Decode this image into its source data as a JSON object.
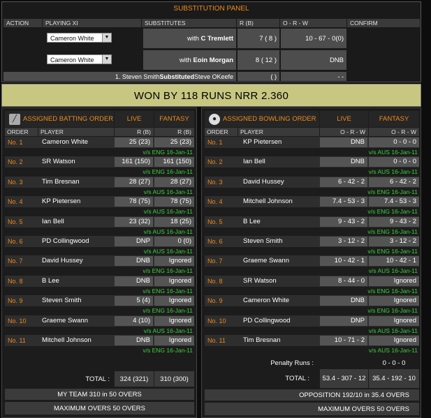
{
  "substitution": {
    "title": "SUBSTITUTION PANEL",
    "headers": [
      "ACTION",
      "PLAYING XI",
      "SUBSTITUTES",
      "R (B)",
      "O - R - W",
      "CONFIRM"
    ],
    "rows": [
      {
        "playing": "Cameron White",
        "prefix": "with",
        "sub": "C Tremlett",
        "rb": "7 ( 8 )",
        "orw": "10 - 67 - 0(0)"
      },
      {
        "playing": "Cameron White",
        "prefix": "with",
        "sub": "Eoin Morgan",
        "rb": "8 ( 12 )",
        "orw": "DNB"
      }
    ],
    "history": {
      "text": "1.  Steven Smith ",
      "bold": "Substituted",
      "rest": " Steve OKeefe",
      "rb": "( )",
      "orw": "- -"
    }
  },
  "result": "WON BY 118 RUNS NRR 2.360",
  "batting": {
    "title": "ASSIGNED BATTING ORDER",
    "tab_live": "LIVE",
    "tab_fantasy": "FANTASY",
    "col_order": "ORDER",
    "col_player": "PLAYER",
    "col_rb": "R (B)",
    "rows": [
      {
        "order": "No. 1",
        "player": "Cameron White",
        "live": "25 (23)",
        "fantasy": "25 (23)",
        "vs": "v/s ENG 16-Jan-11"
      },
      {
        "order": "No. 2",
        "player": "SR Watson",
        "live": "161 (150)",
        "fantasy": "161 (150)",
        "vs": "v/s ENG 16-Jan-11"
      },
      {
        "order": "No. 3",
        "player": "Tim Bresnan",
        "live": "28 (27)",
        "fantasy": "28 (27)",
        "vs": "v/s AUS 16-Jan-11"
      },
      {
        "order": "No. 4",
        "player": "KP Pietersen",
        "live": "78 (75)",
        "fantasy": "78 (75)",
        "vs": "v/s AUS 16-Jan-11"
      },
      {
        "order": "No. 5",
        "player": "Ian Bell",
        "live": "23 (32)",
        "fantasy": "18 (25)",
        "vs": "v/s AUS 16-Jan-11"
      },
      {
        "order": "No. 6",
        "player": "PD Collingwood",
        "live": "DNP",
        "fantasy": "0 (0)",
        "vs": "v/s AUS 16-Jan-11"
      },
      {
        "order": "No. 7",
        "player": "David Hussey",
        "live": "DNB",
        "fantasy": "Ignored",
        "vs": "v/s ENG 16-Jan-11"
      },
      {
        "order": "No. 8",
        "player": "B Lee",
        "live": "DNB",
        "fantasy": "Ignored",
        "vs": "v/s ENG 16-Jan-11"
      },
      {
        "order": "No. 9",
        "player": "Steven Smith",
        "live": "5 (4)",
        "fantasy": "Ignored",
        "vs": "v/s ENG 16-Jan-11"
      },
      {
        "order": "No. 10",
        "player": "Graeme Swann",
        "live": "4 (10)",
        "fantasy": "Ignored",
        "vs": "v/s AUS 16-Jan-11"
      },
      {
        "order": "No. 11",
        "player": "Mitchell Johnson",
        "live": "DNB",
        "fantasy": "Ignored",
        "vs": "v/s ENG 16-Jan-11"
      }
    ],
    "total_label": "TOTAL :",
    "total_live": "324  (321)",
    "total_fantasy": "310  (300)",
    "my_team": "MY TEAM  310 in 50 OVERS",
    "max_overs": "MAXIMUM OVERS  50 OVERS"
  },
  "bowling": {
    "title": "ASSIGNED BOWLING ORDER",
    "tab_live": "LIVE",
    "tab_fantasy": "FANTASY",
    "col_order": "ORDER",
    "col_player": "PLAYER",
    "col_orw_live": "O - R - W",
    "col_orw_fantasy": "O - R - W",
    "rows": [
      {
        "order": "No. 1",
        "player": "KP Pietersen",
        "live": "DNB",
        "fantasy": "0 - 0 - 0",
        "vs": "v/s AUS 16-Jan-11"
      },
      {
        "order": "No. 2",
        "player": "Ian Bell",
        "live": "DNB",
        "fantasy": "0 - 0 - 0",
        "vs": "v/s AUS 16-Jan-11"
      },
      {
        "order": "No. 3",
        "player": "David Hussey",
        "live": "6 - 42 - 2",
        "fantasy": "6 - 42 - 2",
        "vs": "v/s ENG 16-Jan-11"
      },
      {
        "order": "No. 4",
        "player": "Mitchell Johnson",
        "live": "7.4 - 53 - 3",
        "fantasy": "7.4 - 53 - 3",
        "vs": "v/s ENG 16-Jan-11"
      },
      {
        "order": "No. 5",
        "player": "B Lee",
        "live": "9 - 43 - 2",
        "fantasy": "9 - 43 - 2",
        "vs": "v/s ENG 16-Jan-11"
      },
      {
        "order": "No. 6",
        "player": "Steven Smith",
        "live": "3 - 12 - 2",
        "fantasy": "3 - 12 - 2",
        "vs": "v/s ENG 16-Jan-11"
      },
      {
        "order": "No. 7",
        "player": "Graeme Swann",
        "live": "10 - 42 - 1",
        "fantasy": "10 - 42 - 1",
        "vs": "v/s AUS 16-Jan-11"
      },
      {
        "order": "No. 8",
        "player": "SR Watson",
        "live": "8 - 44 - 0",
        "fantasy": "Ignored",
        "vs": "v/s ENG 16-Jan-11"
      },
      {
        "order": "No. 9",
        "player": "Cameron White",
        "live": "DNB",
        "fantasy": "Ignored",
        "vs": "v/s ENG 16-Jan-11"
      },
      {
        "order": "No. 10",
        "player": "PD Collingwood",
        "live": "DNP",
        "fantasy": "Ignored",
        "vs": "v/s AUS 16-Jan-11"
      },
      {
        "order": "No. 11",
        "player": "Tim Bresnan",
        "live": "10 - 71 - 2",
        "fantasy": "Ignored",
        "vs": "v/s AUS 16-Jan-11"
      }
    ],
    "penalty_label": "Penalty Runs :",
    "penalty_value": "0 - 0 - 0",
    "total_label": "TOTAL :",
    "total_live": "53.4 - 307 - 12",
    "total_fantasy": "35.4 - 192 - 10",
    "opposition": "OPPOSITION  192/10 in 35.4 OVERS",
    "max_overs": "MAXIMUM OVERS  50 OVERS"
  }
}
